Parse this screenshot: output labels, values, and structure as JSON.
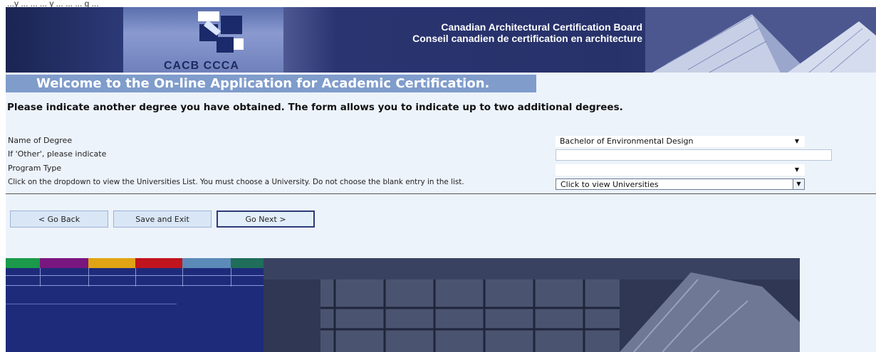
{
  "browser_topline": "...y ... ... ... y ... ... ... g ...",
  "header": {
    "logo_text": "CACB CCCA",
    "board_name_en": "Canadian Architectural Certification Board",
    "board_name_fr": "Conseil canadien de certification en architecture"
  },
  "welcome_banner": "Welcome to the On-line Application for Academic Certification.",
  "instruction": "Please indicate another degree you have obtained. The form allows you to indicate up to two additional degrees.",
  "form": {
    "degree_label": "Name of Degree",
    "degree_value": "Bachelor of Environmental Design",
    "other_label": "If 'Other', please indicate",
    "other_value": "",
    "program_label": "Program Type",
    "program_value": "",
    "university_label": "Click on the dropdown to view the Universities List.  You must choose a University.  Do not choose the blank entry in the list.",
    "university_value": "Click to view Universities"
  },
  "buttons": {
    "back": "< Go Back",
    "save": "Save and Exit",
    "next": "Go Next >"
  },
  "colors": {
    "banner": "#7f9ccb",
    "page_bg": "#edf3fb",
    "header_dark": "#27326a",
    "strip": [
      "#1a9a4a",
      "#7a1680",
      "#e0a414",
      "#c0141e",
      "#5b8ab8",
      "#1f6e5a"
    ]
  }
}
